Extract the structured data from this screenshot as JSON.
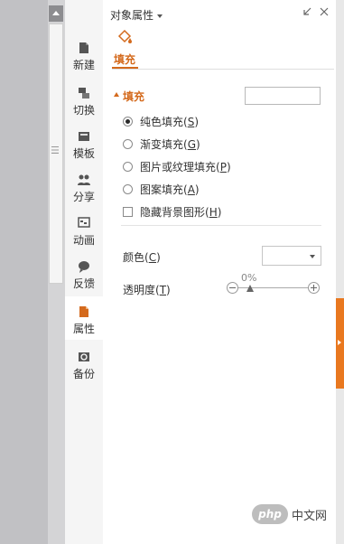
{
  "panel": {
    "title": "对象属性",
    "fill_tab_label": "填充",
    "section_label": "填充",
    "options": [
      {
        "text": "纯色填充(",
        "key": "S",
        "selected": true
      },
      {
        "text": "渐变填充(",
        "key": "G",
        "selected": false
      },
      {
        "text": "图片或纹理填充(",
        "key": "P",
        "selected": false
      },
      {
        "text": "图案填充(",
        "key": "A",
        "selected": false
      }
    ],
    "hide_background": {
      "text": "隐藏背景图形(",
      "key": "H",
      "checked": false
    },
    "color_label": {
      "text": "颜色(",
      "key": "C"
    },
    "transparency_label": {
      "text": "透明度(",
      "key": "T"
    },
    "transparency_value": "0%",
    "close_paren": ")"
  },
  "sidebar": {
    "items": [
      {
        "label": "新建",
        "icon": "new-document-icon"
      },
      {
        "label": "切换",
        "icon": "switch-icon"
      },
      {
        "label": "模板",
        "icon": "template-icon"
      },
      {
        "label": "分享",
        "icon": "share-icon"
      },
      {
        "label": "动画",
        "icon": "animation-icon"
      },
      {
        "label": "反馈",
        "icon": "feedback-icon"
      },
      {
        "label": "属性",
        "icon": "properties-icon",
        "active": true
      },
      {
        "label": "备份",
        "icon": "backup-icon"
      }
    ]
  },
  "watermark": {
    "logo_text": "php",
    "site_text": "中文网"
  },
  "colors": {
    "accent": "#d46a1d",
    "collapse_tab": "#e9781f"
  }
}
